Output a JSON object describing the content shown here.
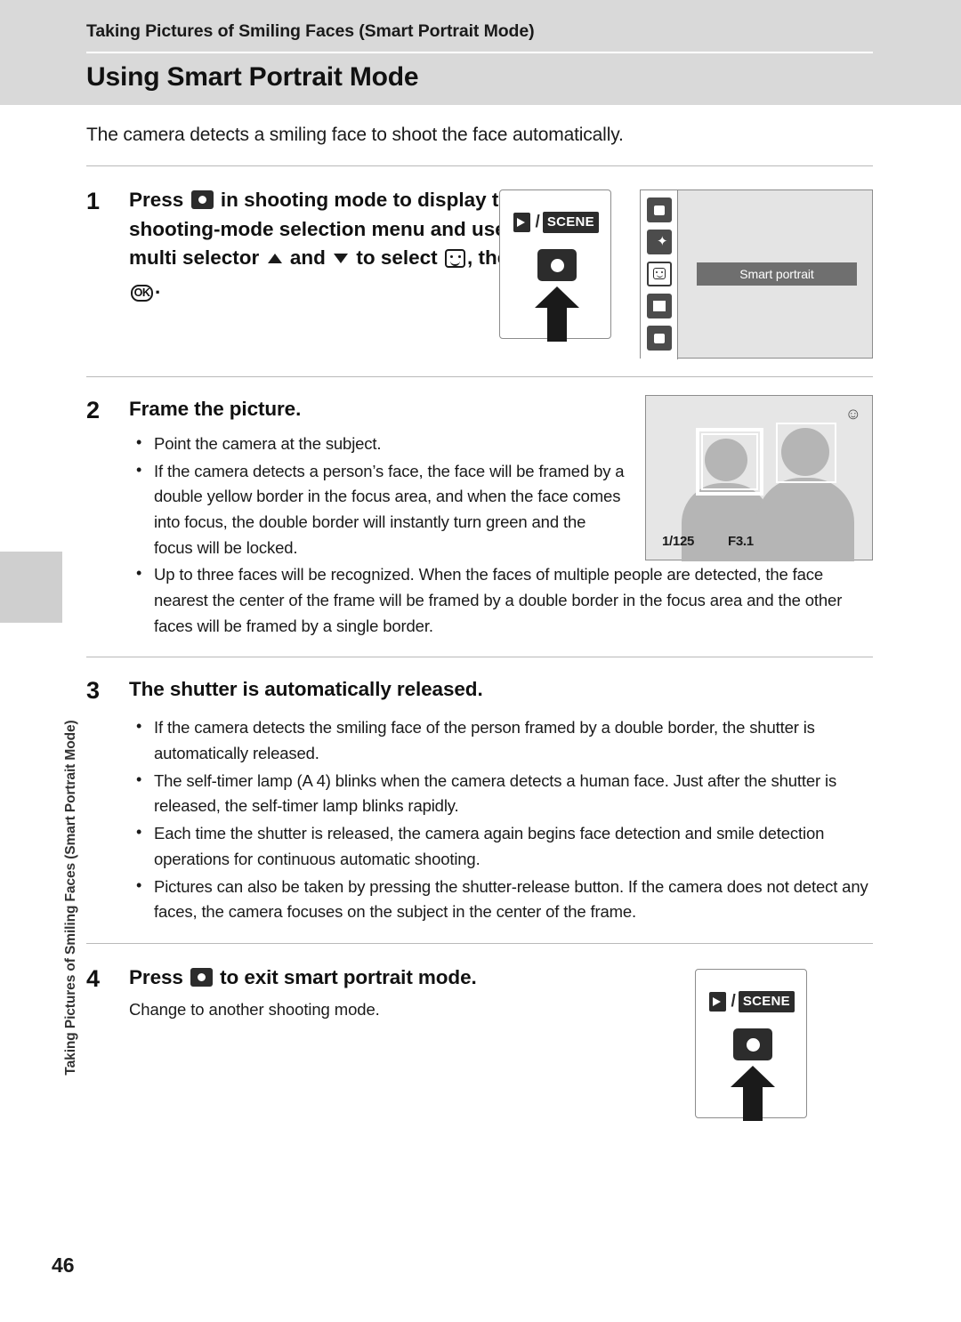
{
  "header": {
    "running_head": "Taking Pictures of Smiling Faces (Smart Portrait Mode)",
    "chapter_title": "Using Smart Portrait Mode",
    "side_tab_text": "Taking Pictures of Smiling Faces (Smart Portrait Mode)"
  },
  "intro": "The camera detects a smiling face to shoot the face automatically.",
  "steps": [
    {
      "number": "1",
      "heading_parts": {
        "a": "Press",
        "b": "in shooting mode to display the shooting-mode selection menu and use the multi selector",
        "c": "and",
        "d": "to select",
        "e": ",",
        "f": "then press"
      },
      "heading_tail": "."
    },
    {
      "number": "2",
      "heading": "Frame the picture.",
      "bullets": [
        "Point the camera at the subject.",
        "If the camera detects a person’s face, the face will be framed by a double yellow border in the focus area, and when the face comes into focus, the double border will instantly turn green and the focus will be locked.",
        "Up to three faces will be recognized. When the faces of multiple people are detected, the face nearest the center of the frame will be framed by a double border in the focus area and the other faces will be framed by a single border."
      ]
    },
    {
      "number": "3",
      "heading": "The shutter is automatically released.",
      "bullets": [
        "If the camera detects the smiling face of the person framed by a double border, the shutter is automatically released.",
        "The self-timer lamp (A 4) blinks when the camera detects a human face. Just after the shutter is released, the self-timer lamp blinks rapidly.",
        "Each time the shutter is released, the camera again begins face detection and smile detection operations for continuous automatic shooting.",
        "Pictures can also be taken by pressing the shutter-release button. If the camera does not detect any faces, the camera focuses on the subject in the center of the frame."
      ]
    },
    {
      "number": "4",
      "heading_parts": {
        "a": "Press",
        "b": "to exit smart portrait mode."
      },
      "note": "Change to another shooting mode."
    }
  ],
  "figures": {
    "mode_dial": {
      "movie_scene_label": "SCENE",
      "slash": "/"
    },
    "monitor": {
      "selected_mode_label": "Smart portrait"
    },
    "framing": {
      "shutter_speed": "1/125",
      "aperture": "F3.1",
      "smile_indicator": "smile-detect-icon"
    }
  },
  "footer": {
    "page_number": "46"
  },
  "colors": {
    "header_band": "#d9d9d9",
    "side_tab": "#cfcfcf",
    "monitor_bg": "#e4e4e4",
    "label_bg": "#6f6f6f",
    "rule": "#b9b9b9"
  }
}
